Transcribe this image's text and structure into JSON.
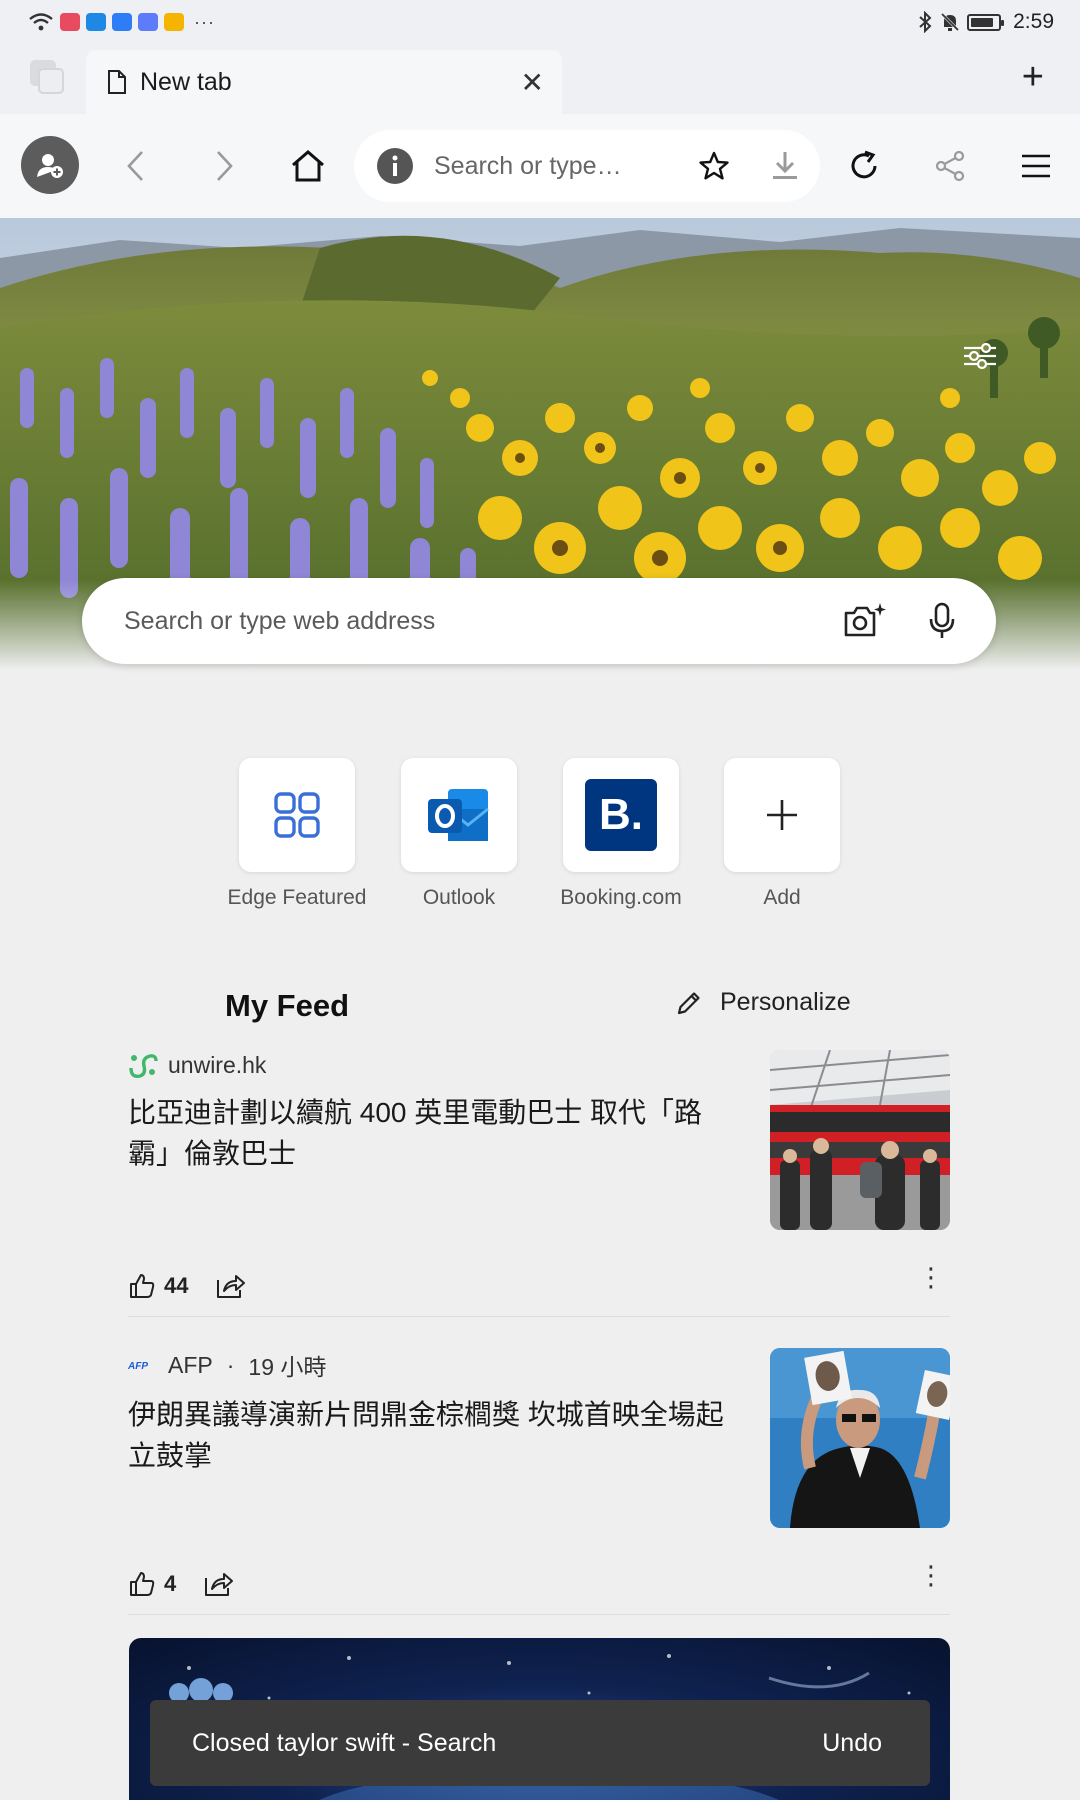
{
  "status_bar": {
    "time": "2:59",
    "more_glyph": "···",
    "notification_app_colors": [
      "#e84a5f",
      "#1e88e5",
      "#2f7df6",
      "#5c7cfa",
      "#f4b400"
    ]
  },
  "tab_strip": {
    "tab_title": "New tab",
    "close_glyph": "✕",
    "new_tab_glyph": "+"
  },
  "toolbar": {
    "omnibox_placeholder": "Search or type…",
    "icons": [
      "profile-icon",
      "back-icon",
      "forward-icon",
      "home-icon",
      "info-icon",
      "star-icon",
      "download-icon",
      "refresh-icon",
      "share-icon",
      "menu-icon"
    ]
  },
  "hero": {
    "search_placeholder": "Search or type web address"
  },
  "quick_links": [
    {
      "label": "Edge Featured",
      "icon": "grid-icon"
    },
    {
      "label": "Outlook",
      "icon": "outlook-icon"
    },
    {
      "label": "Booking.com",
      "icon": "booking-icon",
      "tile_text": "B."
    },
    {
      "label": "Add",
      "icon": "plus-icon"
    }
  ],
  "feed": {
    "title": "My Feed",
    "personalize_label": "Personalize",
    "articles": [
      {
        "source": "unwire.hk",
        "time": "",
        "title": "比亞迪計劃以續航 400 英里電動巴士 取代「路霸」倫敦巴士",
        "likes": "44",
        "more_glyph": "⋮"
      },
      {
        "source": "AFP",
        "separator": "·",
        "time": "19 小時",
        "title": "伊朗異議導演新片問鼎金棕櫚獎 坎城首映全場起立鼓掌",
        "likes": "4",
        "more_glyph": "⋮"
      }
    ]
  },
  "snackbar": {
    "message": "Closed taylor swift - Search",
    "action": "Undo"
  },
  "colors": {
    "background": "#efefef",
    "toolbar": "#f6f7f9",
    "booking_blue": "#003580",
    "outlook_blue": "#0a64c8",
    "edge_grid_blue": "#3b6fd8",
    "snackbar": "#3b3b3b"
  }
}
